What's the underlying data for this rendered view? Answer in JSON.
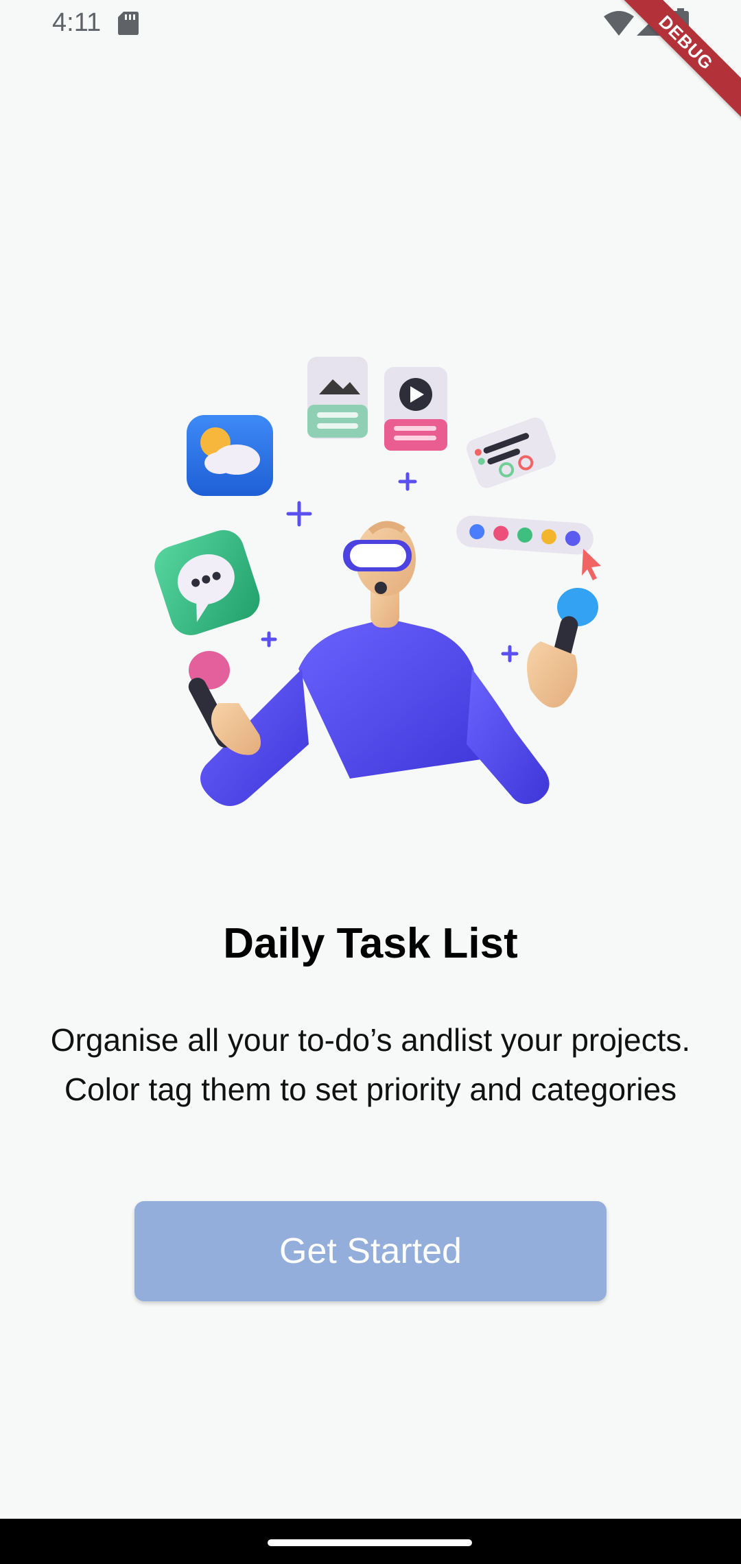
{
  "status_bar": {
    "time": "4:11",
    "icons": [
      "sd-card-icon",
      "wifi-icon",
      "signal-icon",
      "battery-icon"
    ]
  },
  "debug_banner": "DEBUG",
  "illustration": {
    "icon": "person-vr-illustration",
    "accent_color": "#5a4ff0"
  },
  "onboarding": {
    "title": "Daily Task List",
    "description": "Organise all your to-do’s andlist your projects. Color tag them to set priority and categories",
    "cta_label": "Get Started",
    "cta_color": "#94aedb"
  }
}
